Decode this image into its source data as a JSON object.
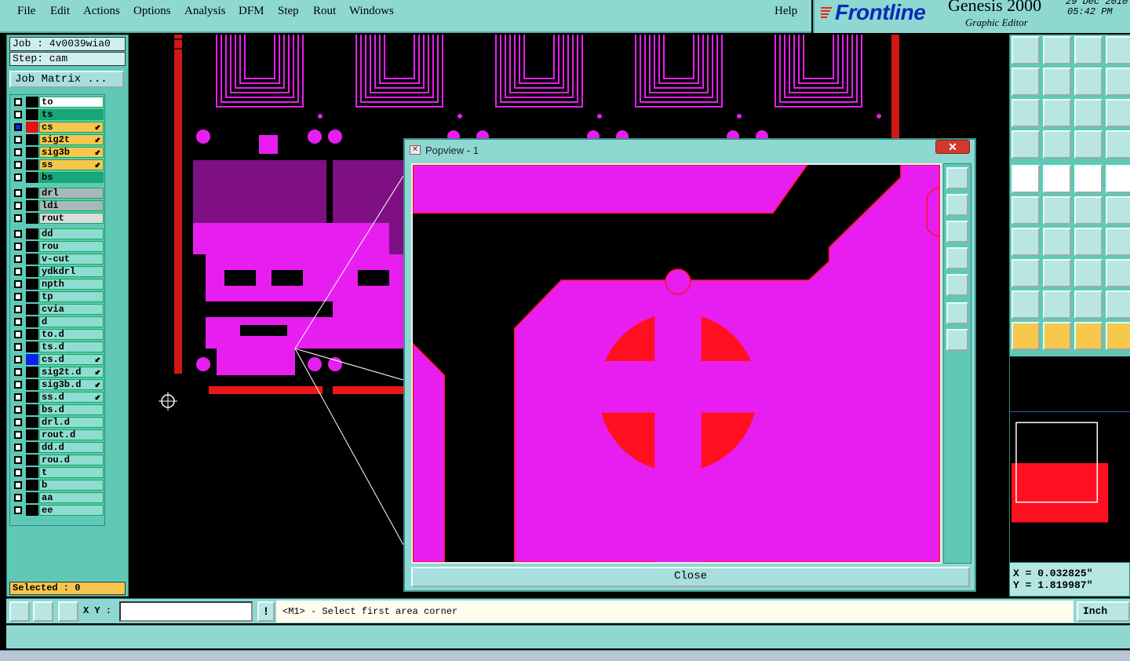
{
  "menu": {
    "items": [
      "File",
      "Edit",
      "Actions",
      "Options",
      "Analysis",
      "DFM",
      "Step",
      "Rout",
      "Windows"
    ],
    "help": "Help"
  },
  "branding": {
    "logo": "Frontline",
    "product": "Genesis 2000",
    "subtitle": "Graphic Editor",
    "date": "29 Dec 2010",
    "time": "05:42 PM"
  },
  "job": {
    "job_label": "Job : 4v0039wia0",
    "step_label": "Step: cam",
    "job_matrix_button": "Job Matrix ..."
  },
  "layers": {
    "group1": [
      {
        "name": "to",
        "color": "#ffffff",
        "swatch": "#000000",
        "affected": false
      },
      {
        "name": "ts",
        "color": "#1aa57a",
        "swatch": "#000000",
        "affected": false
      },
      {
        "name": "cs",
        "color": "#f7c64d",
        "swatch": "#e81010",
        "affected": true,
        "work": true
      },
      {
        "name": "sig2t",
        "color": "#f7c64d",
        "swatch": "#000000",
        "affected": true
      },
      {
        "name": "sig3b",
        "color": "#f7c64d",
        "swatch": "#000000",
        "affected": true
      },
      {
        "name": "ss",
        "color": "#f7c64d",
        "swatch": "#000000",
        "affected": true
      },
      {
        "name": "bs",
        "color": "#1aa57a",
        "swatch": "#000000",
        "affected": false
      }
    ],
    "group2": [
      {
        "name": "drl",
        "color": "#a8b8bc",
        "swatch": "#000000"
      },
      {
        "name": "ldi",
        "color": "#a8b8bc",
        "swatch": "#000000"
      },
      {
        "name": "rout",
        "color": "#dcdcdc",
        "swatch": "#000000"
      }
    ],
    "group3": [
      {
        "name": "dd",
        "swatch": "#000000",
        "affected": false
      },
      {
        "name": "rou",
        "swatch": "#000000",
        "affected": false
      },
      {
        "name": "v-cut",
        "swatch": "#000000",
        "affected": false
      },
      {
        "name": "ydkdrl",
        "swatch": "#000000",
        "affected": false
      },
      {
        "name": "npth",
        "swatch": "#000000",
        "affected": false
      },
      {
        "name": "tp",
        "swatch": "#000000",
        "affected": false
      },
      {
        "name": "cvia",
        "swatch": "#000000",
        "affected": false
      },
      {
        "name": "d",
        "swatch": "#000000",
        "affected": false
      },
      {
        "name": "to.d",
        "swatch": "#000000",
        "affected": false
      },
      {
        "name": "ts.d",
        "swatch": "#000000",
        "affected": false
      },
      {
        "name": "cs.d",
        "swatch": "#1020e8",
        "affected": true
      },
      {
        "name": "sig2t.d",
        "swatch": "#000000",
        "affected": true
      },
      {
        "name": "sig3b.d",
        "swatch": "#000000",
        "affected": true
      },
      {
        "name": "ss.d",
        "swatch": "#000000",
        "affected": true
      },
      {
        "name": "bs.d",
        "swatch": "#000000",
        "affected": false
      },
      {
        "name": "drl.d",
        "swatch": "#000000",
        "affected": false
      },
      {
        "name": "rout.d",
        "swatch": "#000000",
        "affected": false
      },
      {
        "name": "dd.d",
        "swatch": "#000000",
        "affected": false
      },
      {
        "name": "rou.d",
        "swatch": "#000000",
        "affected": false
      },
      {
        "name": "t",
        "swatch": "#000000",
        "affected": false
      },
      {
        "name": "b",
        "swatch": "#000000",
        "affected": false
      },
      {
        "name": "aa",
        "swatch": "#000000",
        "affected": false
      },
      {
        "name": "ee",
        "swatch": "#000000",
        "affected": false
      }
    ],
    "selected_label": "Selected : 0"
  },
  "popview": {
    "title": "Popview - 1",
    "close_label": "Close",
    "side_buttons": [
      "zoom-fit-icon",
      "pan-up-icon",
      "pan-down-icon",
      "pan-left-icon",
      "pan-right-icon",
      "zoom-in-icon",
      "zoom-out-icon"
    ]
  },
  "coords": {
    "x": "X = 0.032825\"",
    "y": "Y = 1.819987\""
  },
  "bottom": {
    "xy_label": "X Y :",
    "xy_value": "",
    "bang": "!",
    "prompt": "<M1> - Select first area corner",
    "units": "Inch"
  },
  "colors": {
    "copper": "#e81ef0",
    "highlight": "#ff1020",
    "panel": "#5fc9b6",
    "menu": "#8fd8d2"
  }
}
